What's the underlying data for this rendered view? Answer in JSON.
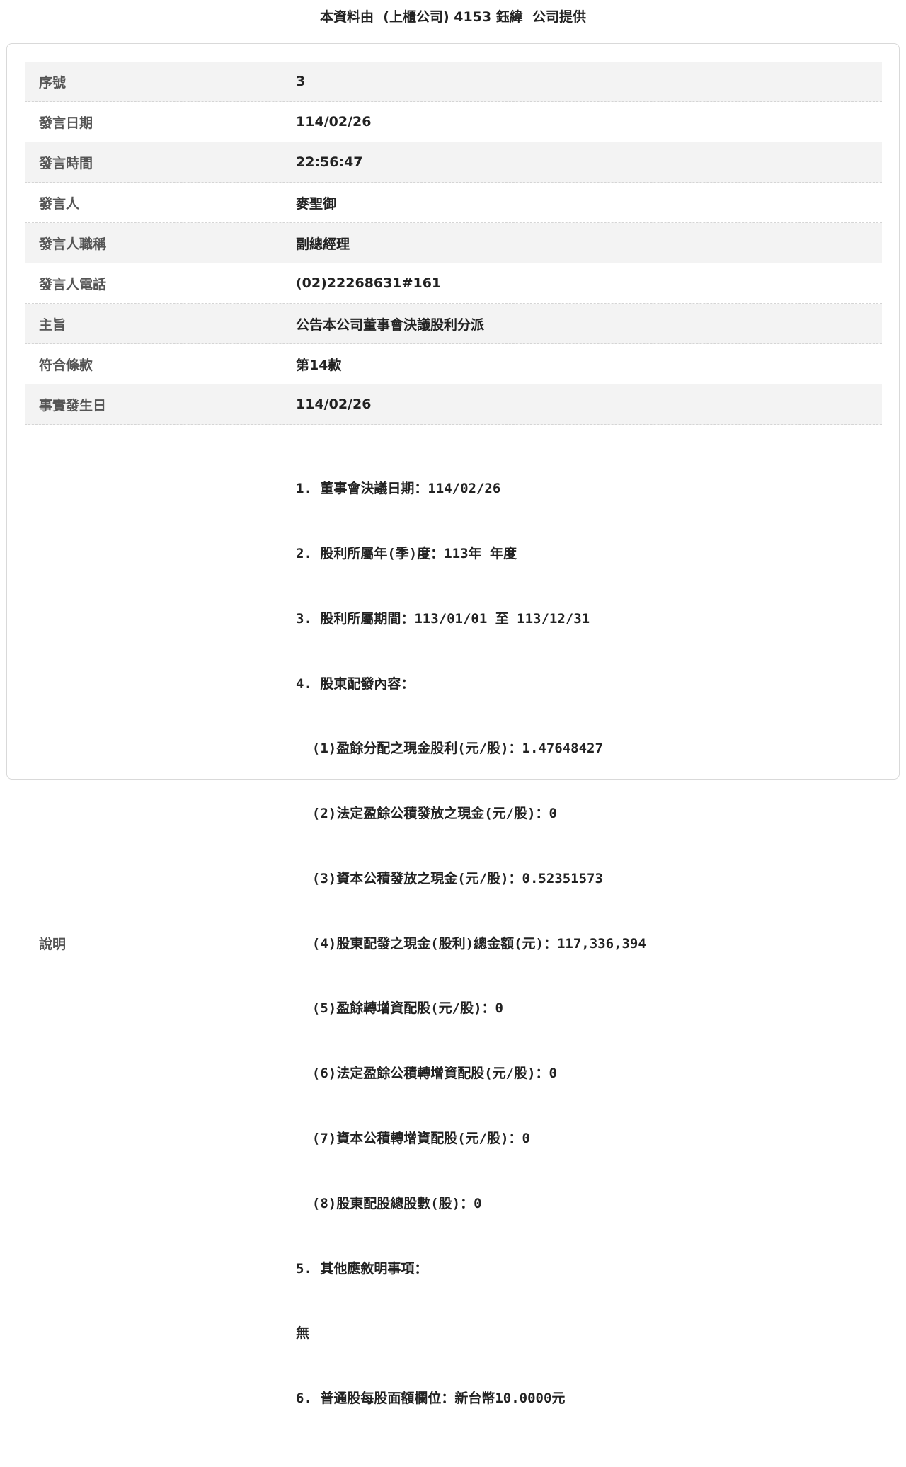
{
  "header": {
    "title": "本資料由  (上櫃公司) 4153 鈺緯  公司提供"
  },
  "fields": [
    {
      "label": "序號",
      "value": "3"
    },
    {
      "label": "發言日期",
      "value": "114/02/26"
    },
    {
      "label": "發言時間",
      "value": "22:56:47"
    },
    {
      "label": "發言人",
      "value": "麥聖御"
    },
    {
      "label": "發言人職稱",
      "value": "副總經理"
    },
    {
      "label": "發言人電話",
      "value": "(02)22268631#161"
    },
    {
      "label": "主旨",
      "value": "公告本公司董事會決議股利分派"
    },
    {
      "label": "符合條款",
      "value": "第14款"
    },
    {
      "label": "事實發生日",
      "value": "114/02/26"
    }
  ],
  "description": {
    "label": "說明",
    "lines": [
      "1. 董事會決議日期：114/02/26",
      "2. 股利所屬年(季)度：113年 年度",
      "3. 股利所屬期間：113/01/01 至 113/12/31",
      "4. 股東配發內容：",
      "  (1)盈餘分配之現金股利(元/股)：1.47648427",
      "  (2)法定盈餘公積發放之現金(元/股)：0",
      "  (3)資本公積發放之現金(元/股)：0.52351573",
      "  (4)股東配發之現金(股利)總金額(元)：117,336,394",
      "  (5)盈餘轉增資配股(元/股)：0",
      "  (6)法定盈餘公積轉增資配股(元/股)：0",
      "  (7)資本公積轉增資配股(元/股)：0",
      "  (8)股東配股總股數(股)：0",
      "5. 其他應敘明事項：",
      "無",
      "6. 普通股每股面額欄位：新台幣10.0000元"
    ]
  }
}
